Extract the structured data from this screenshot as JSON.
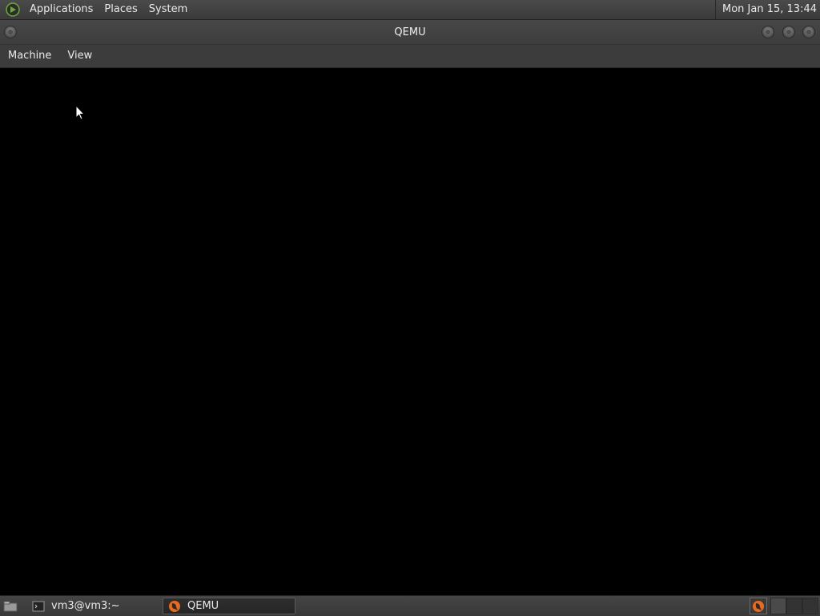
{
  "top_panel": {
    "menus": [
      "Applications",
      "Places",
      "System"
    ],
    "clock": "Mon Jan 15, 13:44",
    "logo_icon": "mate-logo-icon"
  },
  "window": {
    "title": "QEMU",
    "menubar": [
      "Machine",
      "View"
    ]
  },
  "taskbar": {
    "tasks": [
      {
        "label": "vm3@vm3:~",
        "icon": "terminal-icon",
        "active": false
      },
      {
        "label": "QEMU",
        "icon": "qemu-icon",
        "active": true
      }
    ]
  },
  "colors": {
    "panel": "#3f3f3f",
    "display": "#000000",
    "qemu_orange": "#e86a1e",
    "logo_green": "#6aaa3a"
  }
}
